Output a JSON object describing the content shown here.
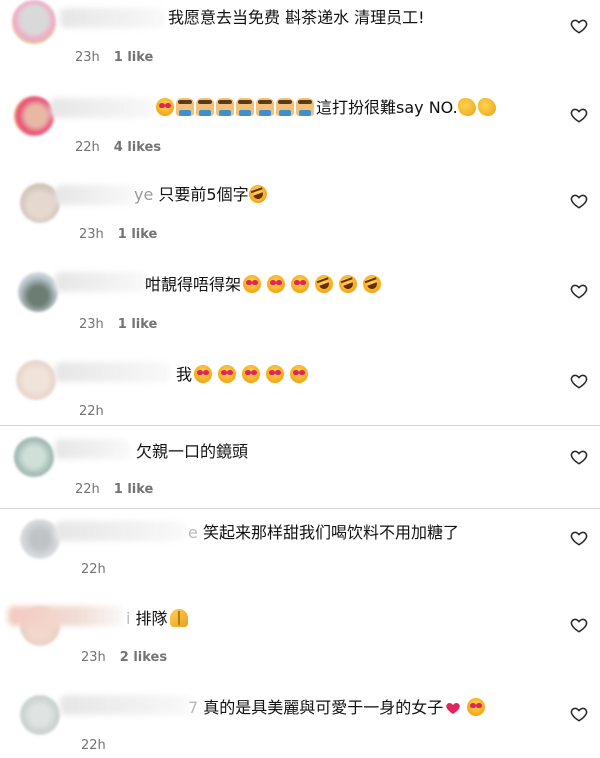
{
  "colors": {
    "text": "#111111",
    "meta": "#737373",
    "divider": "#d4d4d4",
    "heart_outline": "#262626",
    "heart_red": "#e0245e"
  },
  "comments": [
    {
      "text": "我愿意去当免费 斟茶递水 清理员工!",
      "emojis": [],
      "time": "23h",
      "likes": "1 like"
    },
    {
      "text_before": "",
      "emojis_before": [
        "heart-eyes-emoji",
        "person-raising-hand-emoji",
        "person-raising-hand-emoji",
        "person-raising-hand-emoji",
        "person-raising-hand-emoji",
        "person-raising-hand-emoji",
        "person-raising-hand-emoji",
        "person-raising-hand-emoji"
      ],
      "text": "這打扮很難say NO.",
      "emojis": [
        "clapping-hands-emoji",
        "clapping-hands-emoji"
      ],
      "time": "22h",
      "likes": "4 likes"
    },
    {
      "text": "只要前5個字",
      "emojis": [
        "rolling-laughing-emoji"
      ],
      "time": "23h",
      "likes": "1 like",
      "name_tail": "ye"
    },
    {
      "text": "咁靚得唔得架",
      "emojis": [
        "heart-eyes-emoji",
        "heart-eyes-emoji",
        "heart-eyes-emoji",
        "rolling-laughing-emoji",
        "rolling-laughing-emoji",
        "rolling-laughing-emoji"
      ],
      "time": "23h",
      "likes": "1 like"
    },
    {
      "text": "我",
      "emojis": [
        "heart-eyes-emoji",
        "heart-eyes-emoji",
        "heart-eyes-emoji",
        "heart-eyes-emoji",
        "heart-eyes-emoji"
      ],
      "time": "22h",
      "likes": ""
    },
    {
      "text": "欠親一口的鏡頭",
      "emojis": [],
      "time": "22h",
      "likes": "1 like"
    },
    {
      "text": "笑起来那样甜我们喝饮料不用加糖了",
      "emojis": [],
      "time": "22h",
      "likes": "",
      "name_tail": "e"
    },
    {
      "text": "排隊",
      "emojis": [
        "folded-hands-emoji"
      ],
      "time": "23h",
      "likes": "2 likes",
      "name_tail": "i"
    },
    {
      "text": "真的是具美麗與可愛于一身的女子",
      "emojis": [
        "red-heart-emoji",
        "heart-eyes-emoji"
      ],
      "time": "22h",
      "likes": "",
      "name_tail": "7"
    }
  ]
}
